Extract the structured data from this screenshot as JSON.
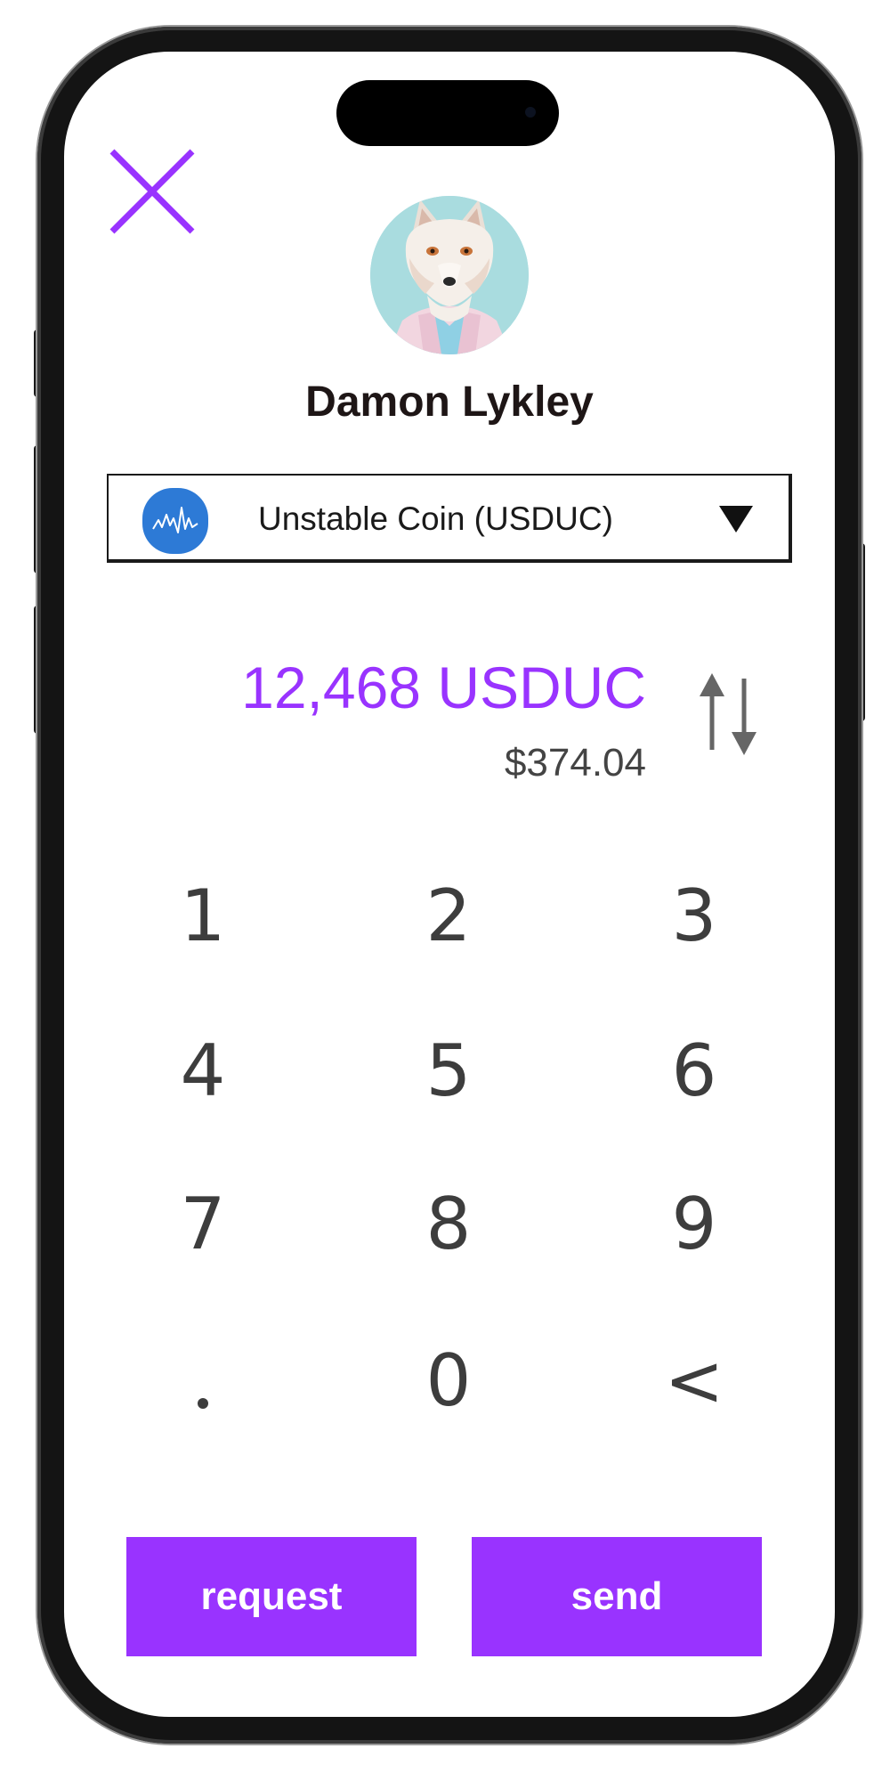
{
  "recipient": {
    "name": "Damon Lykley",
    "avatar_icon": "fox-avatar"
  },
  "coin_selector": {
    "label": "Unstable Coin (USDUC)",
    "logo_icon": "chart-wave-icon",
    "logo_color": "#2d7ad6",
    "dropdown_icon": "triangle-down-icon"
  },
  "amount": {
    "value": "12,468 USDUC",
    "fiat": "$374.04"
  },
  "keypad": {
    "keys": [
      "1",
      "2",
      "3",
      "4",
      "5",
      "6",
      "7",
      "8",
      "9",
      ".",
      "0",
      "<"
    ]
  },
  "actions": {
    "request_label": "request",
    "send_label": "send"
  },
  "colors": {
    "accent": "#9933ff",
    "text_dark": "#1e1616",
    "key_text": "#3d3d3d"
  },
  "icons": {
    "close": "close-icon",
    "swap": "swap-vertical-icon"
  }
}
